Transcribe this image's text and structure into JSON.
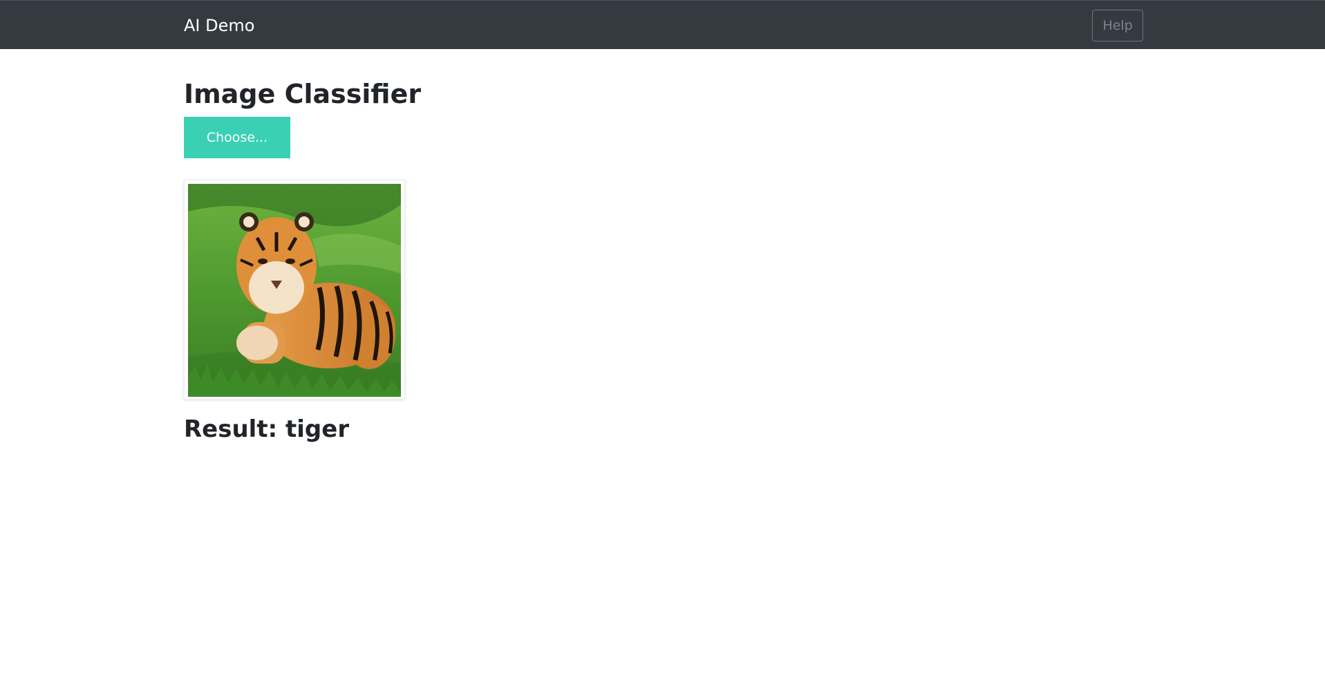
{
  "navbar": {
    "brand": "AI Demo",
    "help_label": "Help"
  },
  "main": {
    "title": "Image Classifier",
    "choose_label": "Choose...",
    "result_prefix": "Result: ",
    "result_value": "tiger",
    "result_text": "Result: tiger"
  },
  "colors": {
    "navbar_bg": "#343a40",
    "choose_button_bg": "#3ad0b3",
    "grass": "#4c9a34",
    "tiger_orange": "#d9862f"
  },
  "image": {
    "subject": "tiger"
  }
}
